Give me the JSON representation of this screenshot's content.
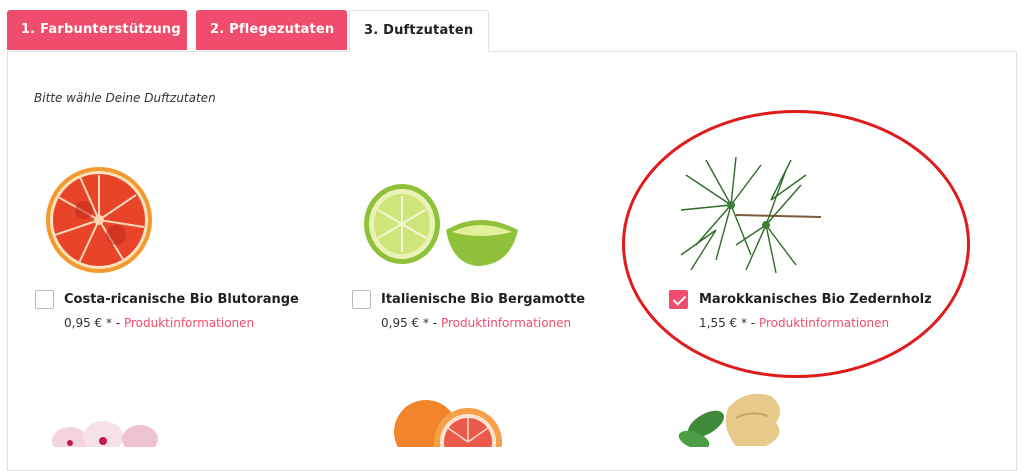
{
  "tabs": [
    {
      "label": "1. Farbunterstützung",
      "active": false
    },
    {
      "label": "2. Pflegezutaten",
      "active": false
    },
    {
      "label": "3. Duftzutaten",
      "active": true
    }
  ],
  "prompt": "Bitte wähle Deine Duftzutaten",
  "products": [
    {
      "name": "Costa-ricanische Bio Blutorange",
      "price": "0,95 € * -",
      "link": "Produktinformationen",
      "checked": false,
      "image": "blood-orange-image"
    },
    {
      "name": "Italienische Bio Bergamotte",
      "price": "0,95 € * -",
      "link": "Produktinformationen",
      "checked": false,
      "image": "bergamot-image"
    },
    {
      "name": "Marokkanisches Bio Zedernholz",
      "price": "1,55 € * -",
      "link": "Produktinformationen",
      "checked": true,
      "image": "cedarwood-image"
    }
  ],
  "next_row_images": [
    "geranium-image",
    "grapefruit-image",
    "ginger-mint-image"
  ],
  "colors": {
    "accent": "#f04c6b",
    "annotation_ring": "#e01b1b"
  }
}
